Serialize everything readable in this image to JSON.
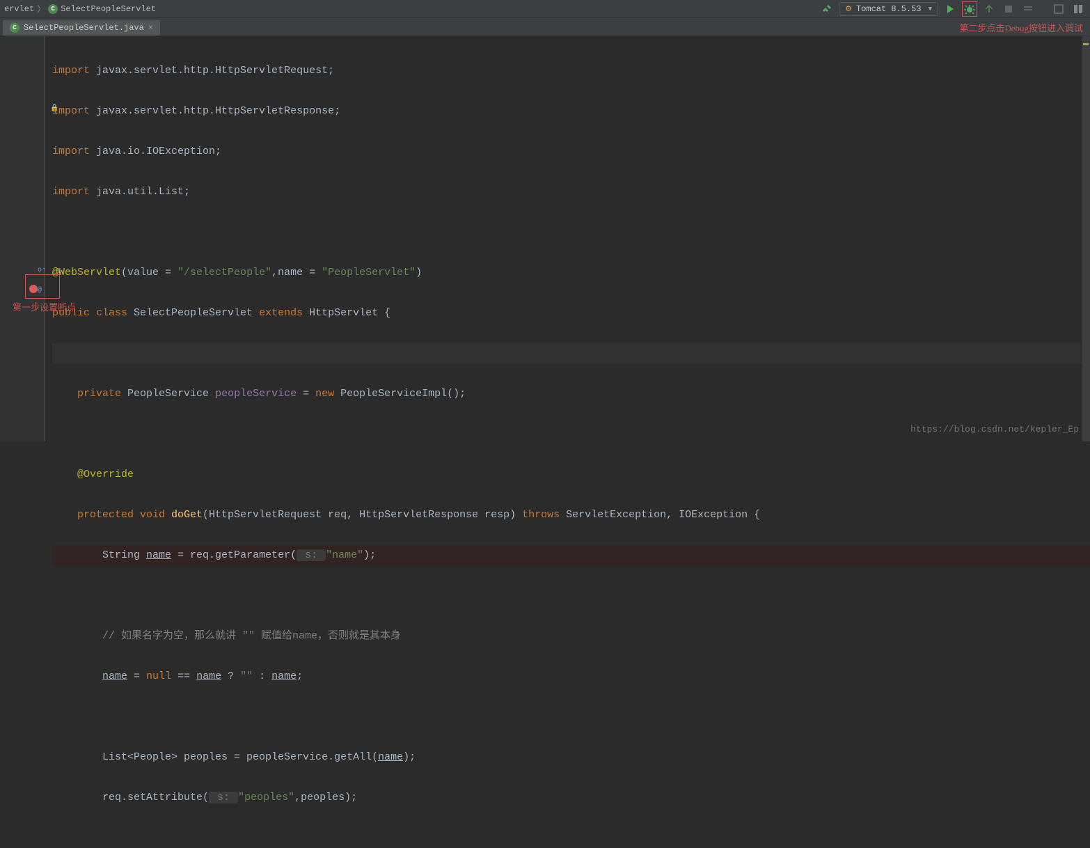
{
  "breadcrumbs": {
    "item1": "ervlet",
    "item2": "SelectPeopleServlet"
  },
  "toolbar": {
    "run_config": "Tomcat 8.5.53",
    "dropdown_arrow": "▼"
  },
  "tab": {
    "filename": "SelectPeopleServlet.java",
    "close": "×"
  },
  "code": {
    "l1": {
      "kw": "import",
      "pkg": " javax.servlet.http.HttpServletRequest;"
    },
    "l2": {
      "kw": "import",
      "pkg": " javax.servlet.http.HttpServletResponse;"
    },
    "l3": {
      "kw": "import",
      "pkg": " java.io.IOException;"
    },
    "l4": {
      "kw": "import",
      "pkg": " java.util.List;"
    },
    "l5": "",
    "l6": {
      "ann": "@WebServlet",
      "a": "(value = ",
      "s1": "\"/selectPeople\"",
      "b": ",name = ",
      "s2": "\"PeopleServlet\"",
      "c": ")"
    },
    "l7": {
      "a": "public class ",
      "cls": "SelectPeopleServlet ",
      "b": "extends ",
      "sup": "HttpServlet {"
    },
    "l8": "",
    "l9": {
      "a": "    private ",
      "t": "PeopleService ",
      "v": "peopleService ",
      "b": "= ",
      "kw": "new ",
      "ctor": "PeopleServiceImpl();"
    },
    "l10": "",
    "l11": {
      "ann": "    @Override"
    },
    "l12": {
      "a": "    protected void ",
      "fn": "doGet",
      "b": "(HttpServletRequest req, HttpServletResponse resp) ",
      "kw": "throws ",
      "ex": "ServletException, IOException {"
    },
    "l13": {
      "a": "        String ",
      "v": "name",
      "b": " = req.getParameter(",
      "hint": " s: ",
      "s": "\"name\"",
      "c": ");"
    },
    "l14": "",
    "l15": {
      "cmt": "        // 如果名字为空，那么就讲 \"\" 赋值给name，否则就是其本身"
    },
    "l16": {
      "a": "        ",
      "v1": "name",
      "b": " = ",
      "kw": "null ",
      "c": "== ",
      "v2": "name",
      "d": " ? ",
      "s": "\"\"",
      "e": " : ",
      "v3": "name",
      "f": ";"
    },
    "l17": "",
    "l18": {
      "a": "        List<People> peoples = peopleService.getAll(",
      "v": "name",
      "b": ");"
    },
    "l19": {
      "a": "        req.setAttribute(",
      "hint": " s: ",
      "s": "\"peoples\"",
      "b": ",peoples);"
    }
  },
  "annotations": {
    "left": "第一步设置断点",
    "right": "第二步点击Debug按钮进入调试"
  },
  "watermark": "https://blog.csdn.net/kepler_Ep"
}
